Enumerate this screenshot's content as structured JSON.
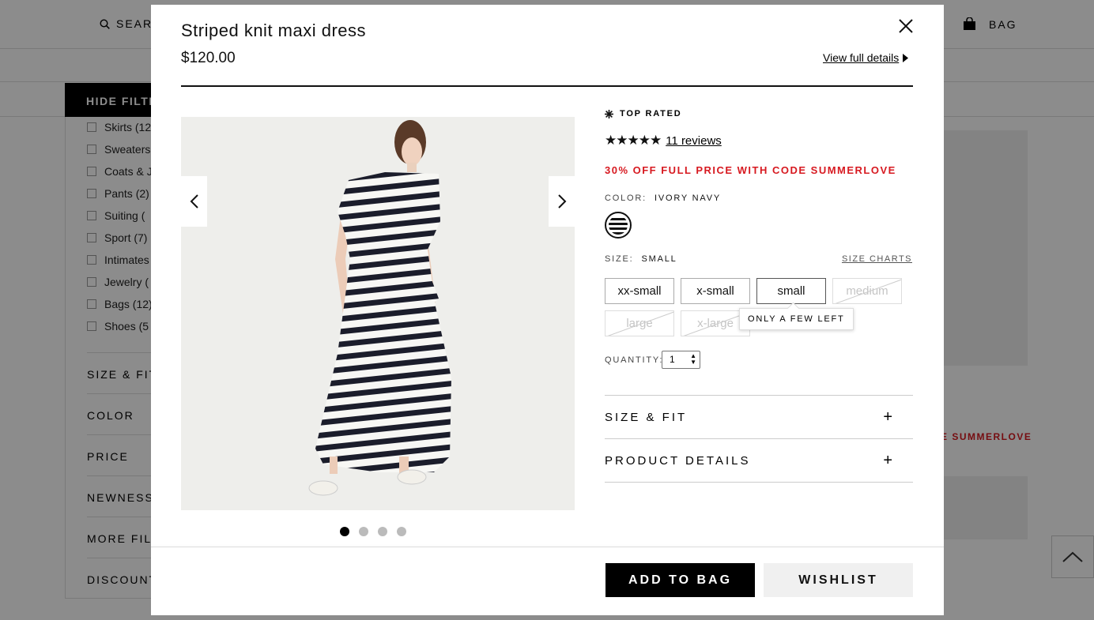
{
  "background": {
    "header": {
      "search_label": "SEARCH",
      "bag_label": "BAG"
    },
    "hide_filters_label": "HIDE FILTERS",
    "categories": [
      "Skirts (12)",
      "Sweaters",
      "Coats & J",
      "Pants (2)",
      "Suiting (",
      "Sport (7)",
      "Intimates",
      "Jewelry (",
      "Bags (12)",
      "Shoes (5"
    ],
    "filter_sections": [
      "SIZE & FIT",
      "COLOR",
      "PRICE",
      "NEWNESS",
      "MORE FILTERS",
      "DISCOUNT"
    ],
    "promo_text": "E SUMMERLOVE"
  },
  "modal": {
    "title": "Striped knit maxi dress",
    "price": "$120.00",
    "view_full_details": "View full details",
    "gallery": {
      "image_count": 4,
      "active_index": 0
    },
    "badge": "TOP RATED",
    "rating": {
      "stars": "★★★★★",
      "value": 5,
      "reviews": "11 reviews"
    },
    "promo": "30% OFF FULL PRICE WITH CODE SUMMERLOVE",
    "color": {
      "label": "COLOR:",
      "value": "IVORY NAVY"
    },
    "size": {
      "label": "SIZE:",
      "value": "SMALL",
      "charts_link": "SIZE CHARTS",
      "options": [
        "xx-small",
        "x-small",
        "small",
        "medium",
        "large",
        "x-large"
      ],
      "tooltip": "ONLY A FEW LEFT"
    },
    "quantity": {
      "label": "QUANTITY:",
      "value": "1"
    },
    "accordions": [
      "SIZE & FIT",
      "PRODUCT DETAILS"
    ],
    "actions": {
      "add_to_bag": "ADD TO BAG",
      "wishlist": "WISHLIST"
    }
  }
}
